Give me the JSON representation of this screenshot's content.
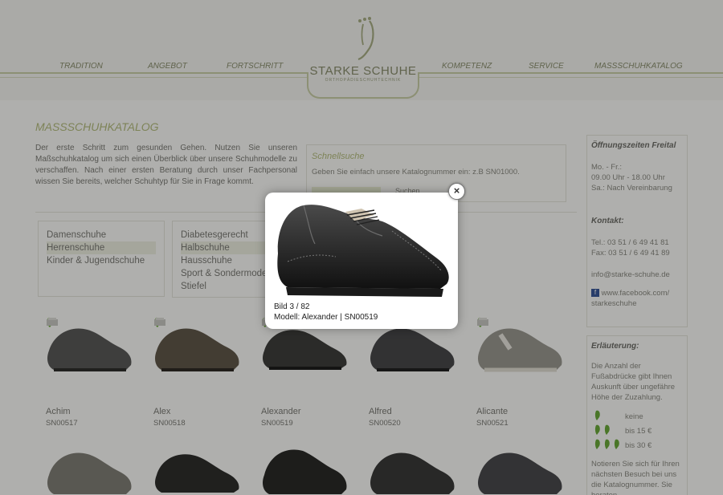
{
  "logo": {
    "name": "STARKE SCHUHE",
    "tagline": "ORTHOPÄDIESCHUHTECHNIK"
  },
  "nav": [
    "TRADITION",
    "ANGEBOT",
    "FORTSCHRITT",
    "KOMPETENZ",
    "SERVICE",
    "MAßSCHUHKATALOG"
  ],
  "page": {
    "title": "MAßSCHUHKATALOG",
    "intro": "Der erste Schritt zum gesunden Gehen. Nutzen Sie unseren Maßschuhkatalog um sich einen Überblick über unsere Schuhmodelle zu verschaffen. Nach einer ersten Beratung durch unser Fachpersonal wissen Sie bereits, welcher Schuhtyp für Sie in Frage kommt."
  },
  "search": {
    "title": "Schnellsuche",
    "desc": "Geben Sie einfach unsere Katalognummer ein: z.B SN01000.",
    "button": "Suchen"
  },
  "categories_left": [
    "Damenschuhe",
    "Herrenschuhe",
    "Kinder & Jugendschuhe"
  ],
  "categories_right": [
    "Diabetesgerecht",
    "Halbschuhe",
    "Hausschuhe",
    "Sport & Sondermodelle",
    "Stiefel"
  ],
  "sidebar": {
    "hours_title": "Öffnungszeiten Freital",
    "hours": [
      "Mo. - Fr.:",
      "09.00 Uhr - 18.00 Uhr",
      "Sa.: Nach Vereinbarung"
    ],
    "contact_title": "Kontakt:",
    "tel": "Tel.: 03 51 / 6 49 41 81",
    "fax": "Fax: 03 51 / 6 49 41 89",
    "email": "info@starke-schuhe.de",
    "facebook": "www.facebook.com/ starkeschuhe",
    "legend_title": "Erläuterung:",
    "legend_desc": "Die Anzahl der Fußabdrücke gibt Ihnen Auskunft über ungefähre Höhe der Zuzahlung.",
    "legend": [
      "keine",
      "bis 15 €",
      "bis 30 €"
    ],
    "note": "Notieren Sie sich für Ihren nächsten Besuch bei uns die Katalognummer. Sie beraten"
  },
  "products": [
    {
      "name": "Achim",
      "code": "SN00517"
    },
    {
      "name": "Alex",
      "code": "SN00518"
    },
    {
      "name": "Alexander",
      "code": "SN00519"
    },
    {
      "name": "Alfred",
      "code": "SN00520"
    },
    {
      "name": "Alicante",
      "code": "SN00521"
    }
  ],
  "lightbox": {
    "counter": "Bild 3 / 82",
    "caption": "Modell: Alexander | SN00519",
    "close": "×"
  },
  "colors": {
    "accent": "#b4bc7d",
    "nav": "#8a8f6e",
    "overlay": "#000000",
    "foot": "#6aaa3a"
  }
}
